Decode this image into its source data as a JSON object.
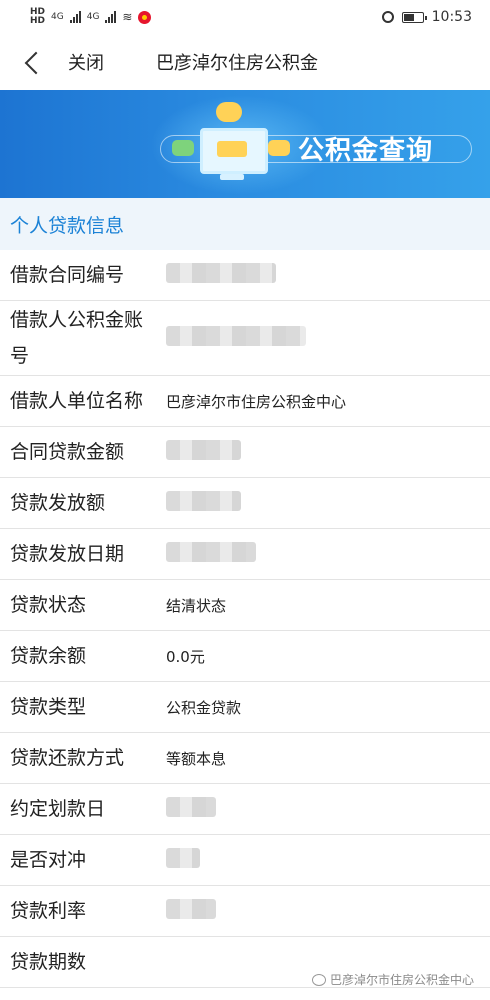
{
  "status_bar": {
    "left_badge_top": "HD",
    "left_badge_bottom": "HD",
    "net1": "4G",
    "net2": "4G",
    "time": "10:53"
  },
  "nav": {
    "back_icon": "chevron-left-icon",
    "close_label": "关闭",
    "title": "巴彦淖尔住房公积金"
  },
  "banner": {
    "title": "公积金查询"
  },
  "section": {
    "title": "个人贷款信息"
  },
  "rows": [
    {
      "label": "借款合同编号",
      "value": "",
      "masked": true
    },
    {
      "label": "借款人公积金账号",
      "value": "",
      "masked": true
    },
    {
      "label": "借款人单位名称",
      "value": "巴彦淖尔市住房公积金中心",
      "masked": false
    },
    {
      "label": "合同贷款金额",
      "value": "",
      "masked": true
    },
    {
      "label": "贷款发放额",
      "value": "",
      "masked": true
    },
    {
      "label": "贷款发放日期",
      "value": "",
      "masked": true
    },
    {
      "label": "贷款状态",
      "value": "结清状态",
      "masked": false
    },
    {
      "label": "贷款余额",
      "value": "0.0元",
      "masked": false
    },
    {
      "label": "贷款类型",
      "value": "公积金贷款",
      "masked": false
    },
    {
      "label": "贷款还款方式",
      "value": "等额本息",
      "masked": false
    },
    {
      "label": "约定划款日",
      "value": "",
      "masked": true
    },
    {
      "label": "是否对冲",
      "value": "",
      "masked": true
    },
    {
      "label": "贷款利率",
      "value": "",
      "masked": true
    },
    {
      "label": "贷款期数",
      "value": "",
      "masked": true
    }
  ],
  "watermark": "巴彦淖尔市住房公积金中心"
}
